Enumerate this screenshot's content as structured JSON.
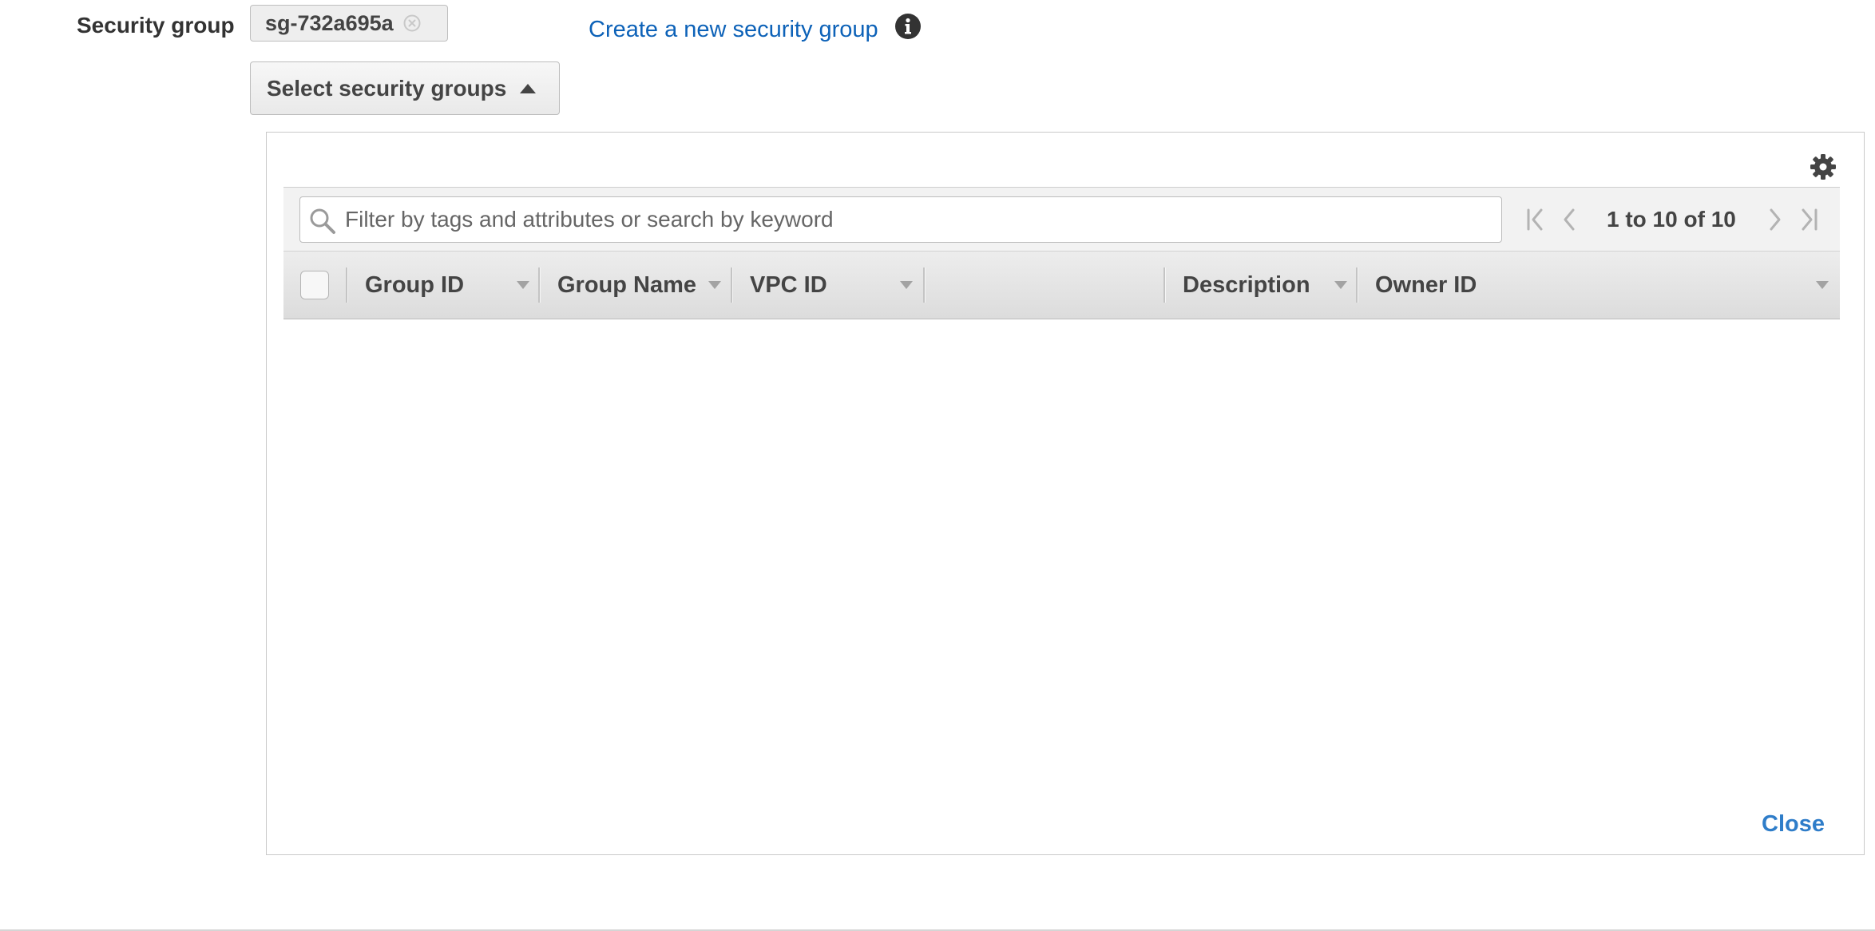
{
  "form": {
    "security_group_label": "Security group",
    "selected_token": "sg-732a695a",
    "create_link": "Create a new security group",
    "select_button_label": "Select security groups"
  },
  "table": {
    "search_placeholder": "Filter by tags and attributes or search by keyword",
    "search_value": "",
    "pagination": "1 to 10 of 10",
    "columns": [
      {
        "label": "Group ID"
      },
      {
        "label": "Group Name"
      },
      {
        "label": "VPC ID"
      },
      {
        "label": ""
      },
      {
        "label": "Description"
      },
      {
        "label": "Owner ID"
      }
    ],
    "rows": []
  },
  "panel": {
    "close_label": "Close"
  },
  "icons": {
    "token_remove": "close-circle-icon",
    "info": "info-icon",
    "select_caret": "caret-up-icon",
    "settings": "gear-icon",
    "search": "search-icon",
    "first_page": "first-page-icon",
    "prev_page": "previous-page-icon",
    "next_page": "next-page-icon",
    "last_page": "last-page-icon",
    "sort": "sort-caret-down-icon"
  },
  "colors": {
    "link": "#0d62b8",
    "close_link": "#2f7dc9",
    "label_text": "#333333",
    "header_bg": "#dcdcdc",
    "toolbar_bg": "#f2f2f2"
  }
}
